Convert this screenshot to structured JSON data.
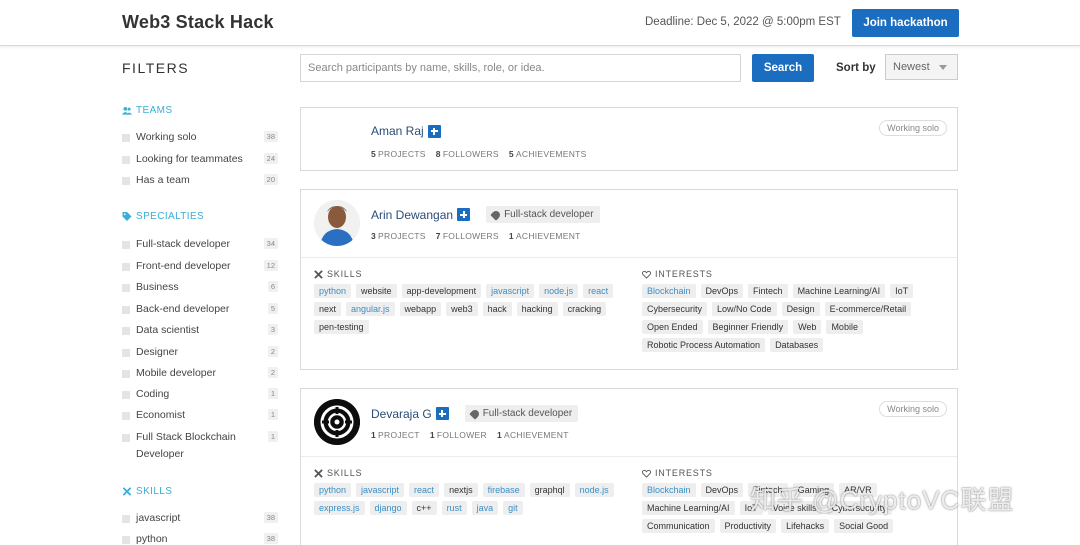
{
  "header": {
    "title": "Web3 Stack Hack",
    "deadline": "Deadline: Dec 5, 2022 @ 5:00pm EST",
    "join_label": "Join hackathon"
  },
  "filters": {
    "title": "FILTERS",
    "teams": {
      "label": "TEAMS",
      "items": [
        {
          "label": "Working solo",
          "count": "38"
        },
        {
          "label": "Looking for teammates",
          "count": "24"
        },
        {
          "label": "Has a team",
          "count": "20"
        }
      ]
    },
    "specialties": {
      "label": "SPECIALTIES",
      "items": [
        {
          "label": "Full-stack developer",
          "count": "34"
        },
        {
          "label": "Front-end developer",
          "count": "12"
        },
        {
          "label": "Business",
          "count": "6"
        },
        {
          "label": "Back-end developer",
          "count": "5"
        },
        {
          "label": "Data scientist",
          "count": "3"
        },
        {
          "label": "Designer",
          "count": "2"
        },
        {
          "label": "Mobile developer",
          "count": "2"
        },
        {
          "label": "Coding",
          "count": "1"
        },
        {
          "label": "Economist",
          "count": "1"
        },
        {
          "label": "Full Stack Blockchain Developer",
          "count": "1"
        }
      ]
    },
    "skills": {
      "label": "SKILLS",
      "items": [
        {
          "label": "javascript",
          "count": "38"
        },
        {
          "label": "python",
          "count": "38"
        }
      ]
    }
  },
  "search": {
    "placeholder": "Search participants by name, skills, role, or idea.",
    "button_label": "Search",
    "sort_label": "Sort by",
    "sort_value": "Newest"
  },
  "participants": [
    {
      "name": "Aman Raj",
      "projects": "5",
      "projects_label": "PROJECTS",
      "followers": "8",
      "followers_label": "FOLLOWERS",
      "achievements": "5",
      "achievements_label": "ACHIEVEMENTS",
      "status": "Working solo"
    },
    {
      "name": "Arin Dewangan",
      "role": "Full-stack developer",
      "projects": "3",
      "projects_label": "PROJECTS",
      "followers": "7",
      "followers_label": "FOLLOWERS",
      "achievements": "1",
      "achievements_label": "ACHIEVEMENT",
      "skills_label": "SKILLS",
      "interests_label": "INTERESTS",
      "skills": [
        "python",
        "website",
        "app-development",
        "javascript",
        "node.js",
        "react",
        "next",
        "angular.js",
        "webapp",
        "web3",
        "hack",
        "hacking",
        "cracking",
        "pen-testing"
      ],
      "interests": [
        "Blockchain",
        "DevOps",
        "Fintech",
        "Machine Learning/AI",
        "IoT",
        "Cybersecurity",
        "Low/No Code",
        "Design",
        "E-commerce/Retail",
        "Open Ended",
        "Beginner Friendly",
        "Web",
        "Mobile",
        "Robotic Process Automation",
        "Databases"
      ]
    },
    {
      "name": "Devaraja G",
      "role": "Full-stack developer",
      "projects": "1",
      "projects_label": "PROJECT",
      "followers": "1",
      "followers_label": "FOLLOWER",
      "achievements": "1",
      "achievements_label": "ACHIEVEMENT",
      "status": "Working solo",
      "skills_label": "SKILLS",
      "interests_label": "INTERESTS",
      "skills": [
        "python",
        "javascript",
        "react",
        "nextjs",
        "firebase",
        "graphql",
        "node.js",
        "express.js",
        "django",
        "c++",
        "rust",
        "java",
        "git"
      ],
      "interests": [
        "Blockchain",
        "DevOps",
        "Fintech",
        "Gaming",
        "AR/VR",
        "Machine Learning/AI",
        "IoT",
        "Voice skills",
        "Cybersecurity",
        "Communication",
        "Productivity",
        "Lifehacks",
        "Social Good"
      ]
    }
  ],
  "watermark": "知乎 @CryptoVC联盟",
  "colors": {
    "accent": "#1a6dbf",
    "filter_heading": "#3aaed6",
    "name": "#2a4e78",
    "chip_link": "#3a8fc6"
  }
}
